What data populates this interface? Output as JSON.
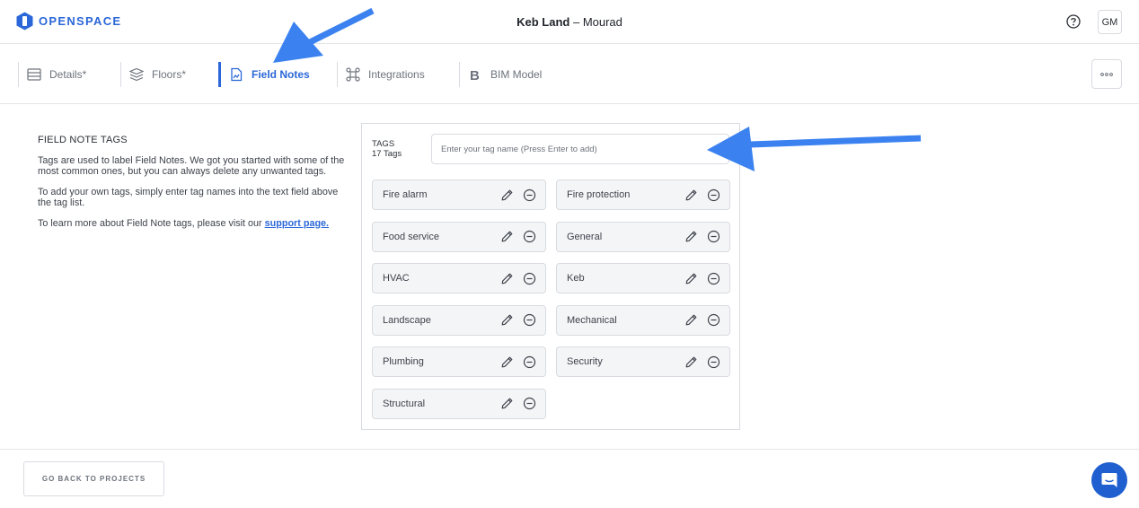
{
  "header": {
    "logo_text": "OPENSPACE",
    "project_name": "Keb Land",
    "separator": " – ",
    "user_name": "Mourad",
    "avatar_initials": "GM"
  },
  "tabs": [
    {
      "label": "Details*",
      "icon": "details-icon",
      "active": false
    },
    {
      "label": "Floors*",
      "icon": "layers-icon",
      "active": false
    },
    {
      "label": "Field Notes",
      "icon": "field-notes-icon",
      "active": true
    },
    {
      "label": "Integrations",
      "icon": "integrations-icon",
      "active": false
    },
    {
      "label": "BIM Model",
      "icon": "bim-icon",
      "active": false
    }
  ],
  "info": {
    "heading": "FIELD NOTE TAGS",
    "para1": "Tags are used to label Field Notes. We got you started with some of the most common ones, but you can always delete any unwanted tags.",
    "para2": "To add your own tags, simply enter tag names into the text field above the tag list.",
    "para3_prefix": "To learn more about Field Note tags, please visit our ",
    "para3_link": "support page."
  },
  "tags_panel": {
    "label": "TAGS",
    "count": "17 Tags",
    "input_placeholder": "Enter your tag name (Press Enter to add)",
    "input_value": "",
    "items": [
      "Fire alarm",
      "Fire protection",
      "Food service",
      "General",
      "HVAC",
      "Keb",
      "Landscape",
      "Mechanical",
      "Plumbing",
      "Security",
      "Structural"
    ]
  },
  "footer": {
    "back_label": "GO BACK TO PROJECTS"
  },
  "colors": {
    "accent": "#2b67d8",
    "annotation_arrow": "#3b82f0",
    "chat": "#1f5fd0"
  }
}
